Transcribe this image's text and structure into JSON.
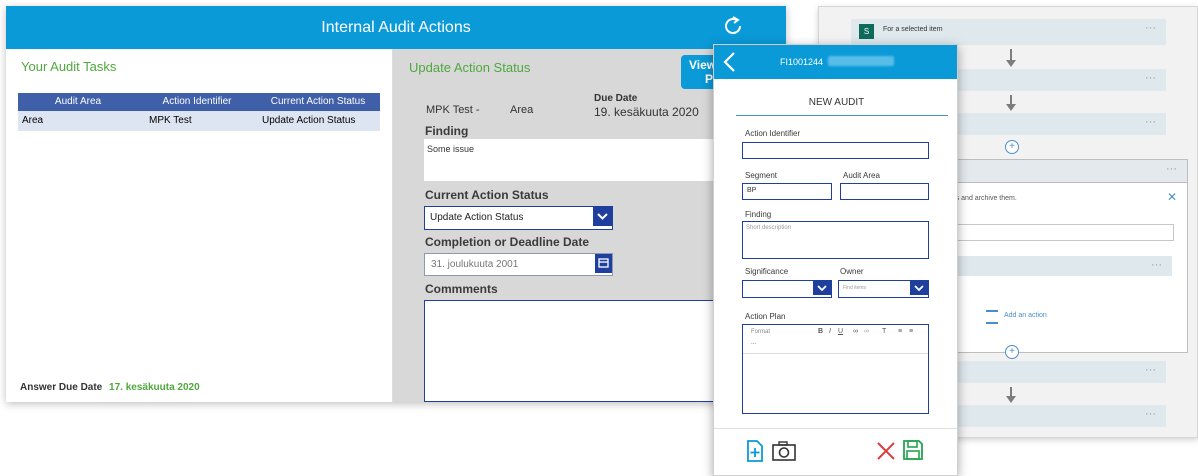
{
  "flow": {
    "first_step_label": "For a selected item",
    "dots": "···",
    "fragment_text": "ems and archive them.",
    "add_action_label": "Add an action",
    "close_glyph": "✕",
    "plus_glyph": "+"
  },
  "app": {
    "title": "Internal Audit Actions",
    "left": {
      "heading": "Your Audit Tasks",
      "columns": [
        "Audit Area",
        "Action Identifier",
        "Current Action Status"
      ],
      "rows": [
        [
          "Area",
          "MPK Test",
          "Update Action Status"
        ]
      ],
      "answer_due_label": "Answer Due Date",
      "answer_due_value": "17. kesäkuuta 2020"
    },
    "right": {
      "heading": "Update Action Status",
      "view_button_line1": "View",
      "view_button_line2": "P",
      "identifier": "MPK Test -",
      "area": "Area",
      "due_label": "Due Date",
      "due_value": "19. kesäkuuta 2020",
      "finding_label": "Finding",
      "finding_value": "Some issue",
      "status_label": "Current Action Status",
      "status_value": "Update Action Status",
      "completion_label": "Completion or Deadline Date",
      "completion_value": "31. joulukuuta 2001",
      "comments_label": "Commments"
    }
  },
  "phone": {
    "record_id": "FI1001244",
    "form_title": "NEW AUDIT",
    "action_identifier_label": "Action Identifier",
    "segment_label": "Segment",
    "segment_value": "BP",
    "audit_area_label": "Audit Area",
    "finding_label": "Finding",
    "finding_placeholder": "Short description",
    "significance_label": "Significance",
    "owner_label": "Owner",
    "owner_placeholder": "Find items",
    "action_plan_label": "Action Plan",
    "toolbar_format": "Format",
    "toolbar_ellipsis": "..."
  },
  "colors": {
    "accent": "#0a9ad8",
    "green": "#4fa83d",
    "navy": "#1f3f9e",
    "header_blue": "#3f5fa8",
    "row_highlight": "#dde5f3",
    "red": "#e03a3a",
    "save_green": "#23a550"
  }
}
